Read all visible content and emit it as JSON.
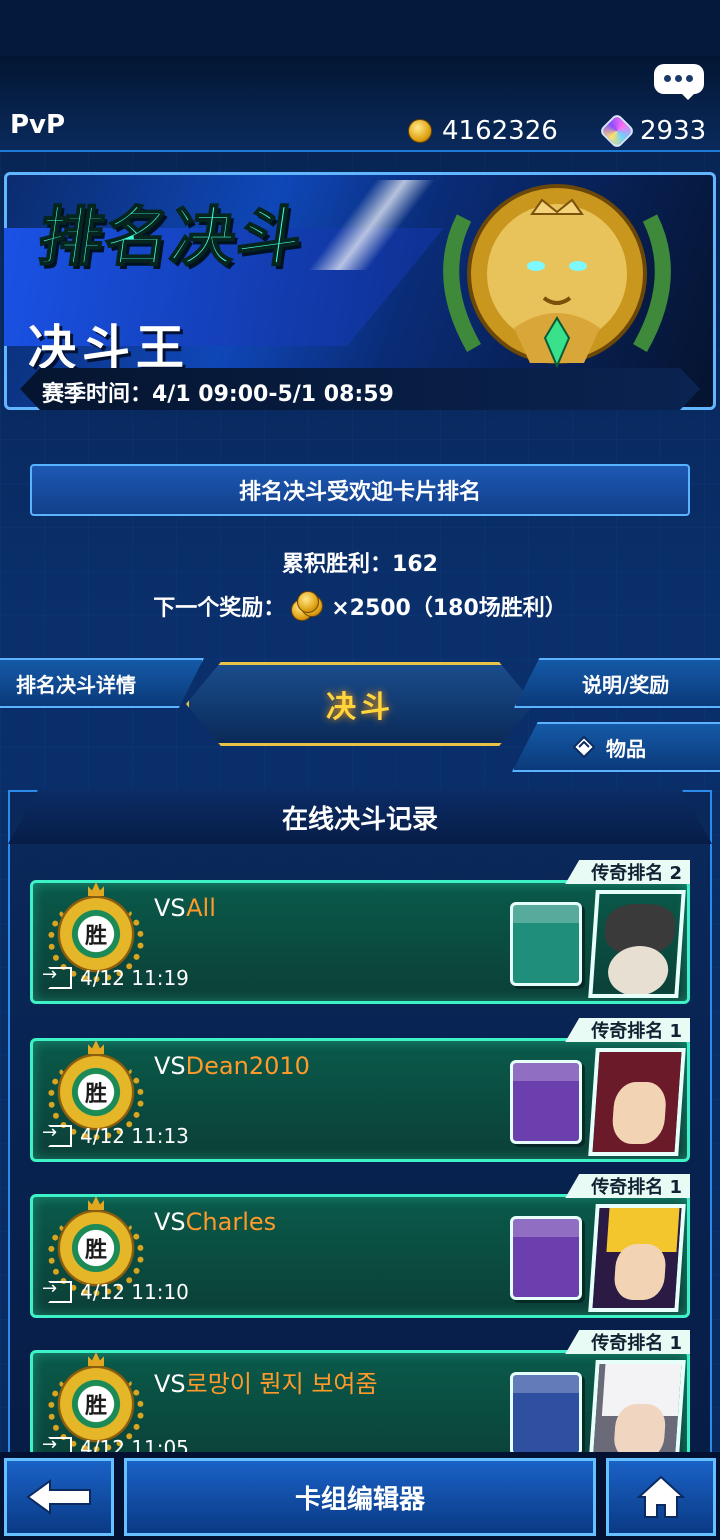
{
  "header": {
    "title": "PvP",
    "gold": "4162326",
    "gems": "2933"
  },
  "banner": {
    "title": "排名决斗",
    "rank": "决斗王",
    "season": "赛季时间：4/1 09:00-5/1 08:59"
  },
  "popular_button": "排名决斗受欢迎卡片排名",
  "stats": {
    "wins": "累积胜利：162",
    "reward_label": "下一个奖励：",
    "reward_value": "×2500（180场胜利）"
  },
  "menu": {
    "detail": "排名决斗详情",
    "duel": "决斗",
    "info": "说明/奖励",
    "items": "物品"
  },
  "records": {
    "title": "在线决斗记录",
    "items": [
      {
        "rank": "传奇排名 2",
        "result": "胜",
        "vs": "VS",
        "opponent": "All",
        "time": "4/12 11:19",
        "deck_color": "#1f8f7c"
      },
      {
        "rank": "传奇排名 1",
        "result": "胜",
        "vs": "VS",
        "opponent": "Dean2010",
        "time": "4/12 11:13",
        "deck_color": "#6b3fae"
      },
      {
        "rank": "传奇排名 1",
        "result": "胜",
        "vs": "VS",
        "opponent": "Charles",
        "time": "4/12 11:10",
        "deck_color": "#6b3fae"
      },
      {
        "rank": "传奇排名 1",
        "result": "胜",
        "vs": "VS",
        "opponent": "로망이 뭔지 보여줌",
        "time": "4/12 11:05",
        "deck_color": "#2f4fa0"
      }
    ]
  },
  "bottom": {
    "deck_editor": "卡组编辑器"
  }
}
